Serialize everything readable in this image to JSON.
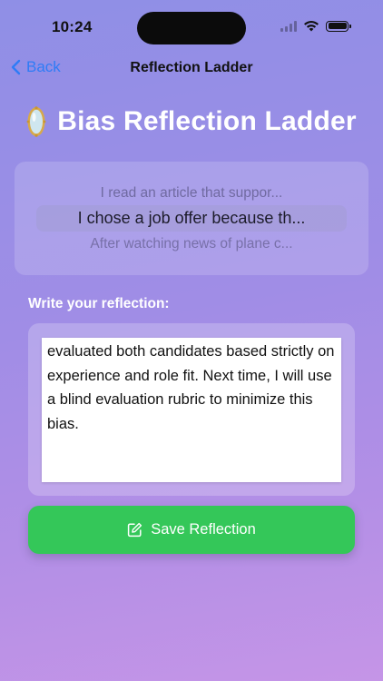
{
  "status_bar": {
    "time": "10:24",
    "icons": [
      "signal-icon",
      "wifi-icon",
      "battery-icon"
    ]
  },
  "nav": {
    "back_label": "Back",
    "back_icon": "chevron-left-icon",
    "title": "Reflection Ladder"
  },
  "page": {
    "title": "Bias Reflection Ladder",
    "title_icon": "mirror-icon"
  },
  "picker": {
    "options": [
      "I read an article that suppor...",
      "I chose a job offer because th...",
      "After watching news of plane c..."
    ],
    "selected_index": 1
  },
  "reflection": {
    "label": "Write your reflection:",
    "text": "evaluated both candidates based strictly on experience and role fit. Next time, I will use a blind evaluation rubric to minimize this bias."
  },
  "save_button": {
    "label": "Save Reflection",
    "icon": "square-pencil-icon"
  },
  "colors": {
    "accent_blue": "#2f7cf6",
    "save_green": "#34c759",
    "background_top": "#8f8fe6",
    "background_bottom": "#c595e7"
  }
}
